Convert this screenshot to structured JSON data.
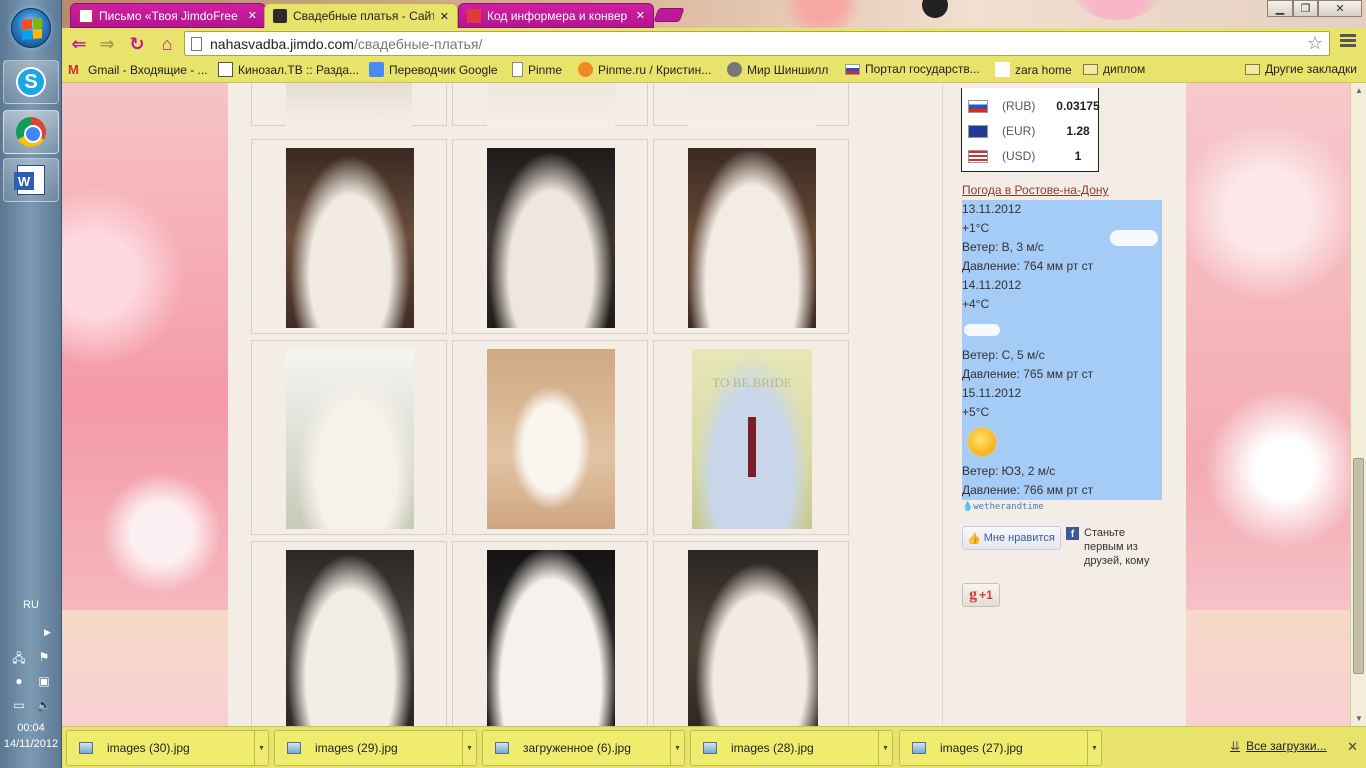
{
  "tabs": [
    {
      "title": "Письмо «Твоя JimdoFree",
      "active": false
    },
    {
      "title": "Свадебные платья - Сайт",
      "active": true
    },
    {
      "title": "Код информера и конвер",
      "active": false
    }
  ],
  "address": {
    "host": "nahasvadba.jimdo.com",
    "path": "/свадебные-платья/"
  },
  "bookmarks": [
    {
      "label": "Gmail - Входящие - ...",
      "icon": "gmail-icon"
    },
    {
      "label": "Кинозал.ТВ :: Разда...",
      "icon": "kinozal-icon"
    },
    {
      "label": "Переводчик Google",
      "icon": "translate-icon"
    },
    {
      "label": "Pinme",
      "icon": "page-icon"
    },
    {
      "label": "Pinme.ru / Кристин...",
      "icon": "pin-icon"
    },
    {
      "label": "Мир Шиншилл",
      "icon": "chinchilla-icon"
    },
    {
      "label": "Портал государств...",
      "icon": "russia-flag-icon"
    },
    {
      "label": "zara home",
      "icon": "blank-icon"
    },
    {
      "label": "диплом",
      "icon": "folder-icon"
    }
  ],
  "other_bookmarks": "Другие закладки",
  "currency": [
    {
      "code": "(RUB)",
      "value": "0.03175",
      "flag": "russia"
    },
    {
      "code": "(EUR)",
      "value": "1.28",
      "flag": "eu"
    },
    {
      "code": "(USD)",
      "value": "1",
      "flag": "usa"
    }
  ],
  "weather": {
    "link": "Погода в Ростове-на-Дону",
    "days": [
      {
        "date": "13.11.2012",
        "temp": "+1°C",
        "wind": "Ветер: В, 3 м/с",
        "pressure": "Давление: 764 мм рт ст",
        "icon": "cloud"
      },
      {
        "date": "14.11.2012",
        "temp": "+4°C",
        "wind": "Ветер: С, 5 м/с",
        "pressure": "Давление: 765 мм рт ст",
        "icon": "cloud"
      },
      {
        "date": "15.11.2012",
        "temp": "+5°C",
        "wind": "Ветер: ЮЗ, 2 м/с",
        "pressure": "Давление: 766 мм рт ст",
        "icon": "sun"
      }
    ],
    "brand": "wetherandtime"
  },
  "social": {
    "like": "Мне нравится",
    "fb_text": "Станьте первым из друзей, кому",
    "gplus": "+1"
  },
  "gallery_watermarks": [
    "TO BE BRIDE"
  ],
  "downloads": [
    {
      "name": "images (30).jpg"
    },
    {
      "name": "images (29).jpg"
    },
    {
      "name": "загруженное (6).jpg"
    },
    {
      "name": "images (28).jpg"
    },
    {
      "name": "images (27).jpg"
    }
  ],
  "downloads_all": "Все загрузки...",
  "taskbar": {
    "lang": "RU",
    "time": "00:04",
    "date": "14/11/2012"
  },
  "colors": {
    "chrome_theme": "#e8e36a",
    "tab_inactive": "#c0189a",
    "page_bg": "#f3ede6",
    "weather_bg": "#a5cbf7",
    "link": "#8b3a2f"
  }
}
